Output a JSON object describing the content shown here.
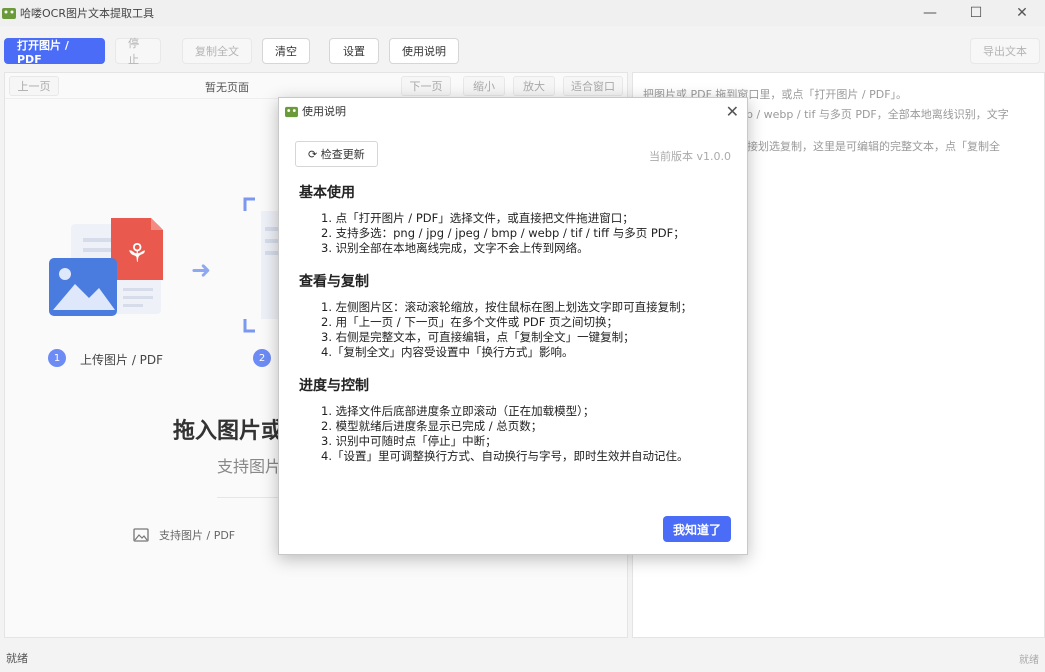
{
  "window": {
    "title": "哈喽OCR图片文本提取工具",
    "minimize": "—",
    "maximize": "☐",
    "close": "✕"
  },
  "toolbar": {
    "open_label": "打开图片 / PDF",
    "stop_label": "停止",
    "copy_all_label": "复制全文",
    "clear_label": "清空",
    "settings_label": "设置",
    "help_label": "使用说明",
    "export_label": "导出文本"
  },
  "nav": {
    "prev_label": "上一页",
    "page_label": "暂无页面",
    "next_label": "下一页",
    "zoom_out_label": "缩小",
    "zoom_in_label": "放大",
    "fit_label": "适合窗口"
  },
  "left": {
    "step1_num": "1",
    "step1_label": "上传图片 / PDF",
    "step2_num": "2",
    "big_text": "拖入图片或",
    "sub_text": "支持图片",
    "hint_label": "支持图片 / PDF",
    "arrow": "➜"
  },
  "right": {
    "line1": "把图片或 PDF 拖到窗口里，或点「打开图片 / PDF」。",
    "line2": "np / webp / tif 与多页 PDF，全部本地离线识别，文字",
    "line3": "接划选复制，这里是可编辑的完整文本，点「复制全"
  },
  "status": {
    "left": "就绪",
    "right": "就绪"
  },
  "dialog": {
    "title": "使用说明",
    "close": "✕",
    "check_update": "⟳  检查更新",
    "version": "当前版本 v1.0.0",
    "sec1": "基本使用",
    "sec1_items": [
      "1. 点「打开图片 / PDF」选择文件，或直接把文件拖进窗口；",
      "2. 支持多选：png / jpg / jpeg / bmp / webp / tif / tiff 与多页 PDF；",
      "3. 识别全部在本地离线完成，文字不会上传到网络。"
    ],
    "sec2": "查看与复制",
    "sec2_items": [
      "1. 左侧图片区：滚动滚轮缩放，按住鼠标在图上划选文字即可直接复制；",
      "2. 用「上一页 / 下一页」在多个文件或 PDF 页之间切换；",
      "3. 右侧是完整文本，可直接编辑，点「复制全文」一键复制；",
      "4.「复制全文」内容受设置中「换行方式」影响。"
    ],
    "sec3": "进度与控制",
    "sec3_items": [
      "1. 选择文件后底部进度条立即滚动（正在加载模型）；",
      "2. 模型就绪后进度条显示已完成 / 总页数；",
      "3. 识别中可随时点「停止」中断；",
      "4.「设置」里可调整换行方式、自动换行与字号，即时生效并自动记住。"
    ],
    "ok_label": "我知道了"
  },
  "colors": {
    "accent": "#4a6cf7",
    "pdf_red": "#e9594e",
    "image_blue": "#4a7ce0"
  }
}
